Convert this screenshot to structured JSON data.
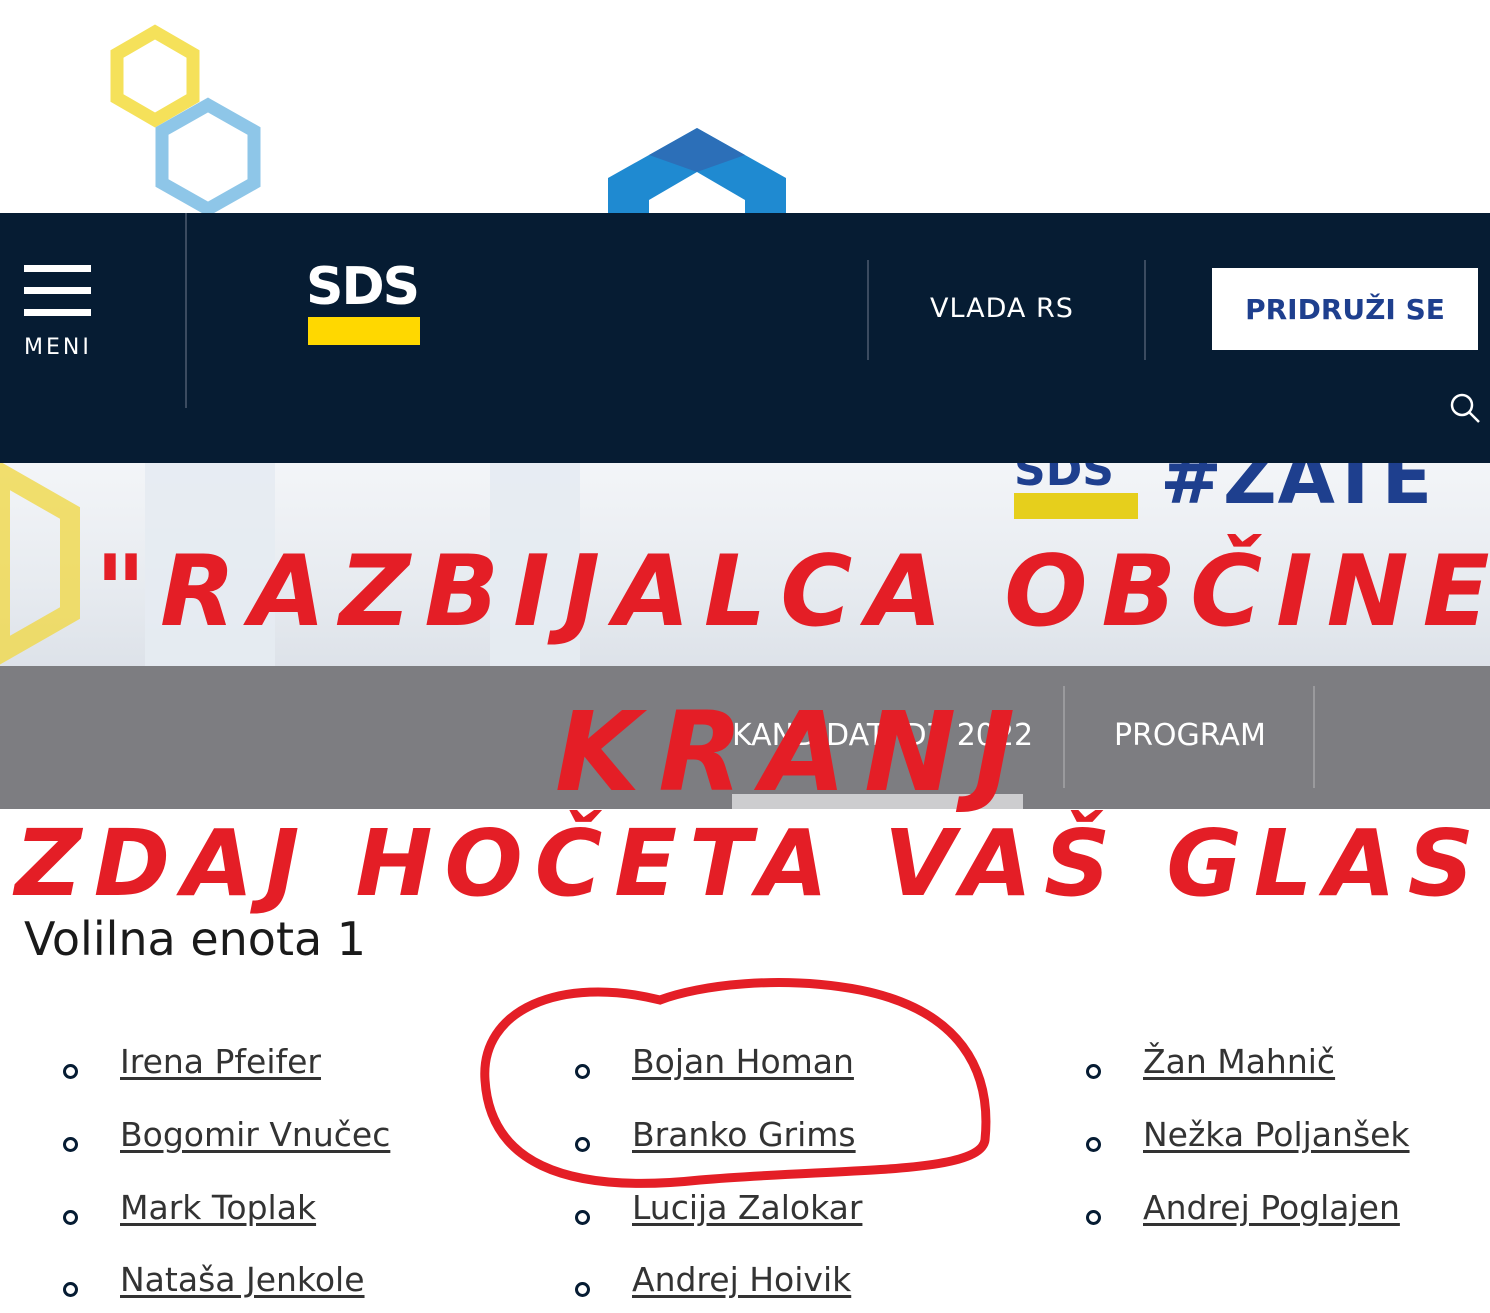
{
  "header": {
    "menu_label": "MENI",
    "logo_text": "SDS",
    "nav_link": "VLADA RS",
    "join_button": "PRIDRUŽI SE",
    "search_icon": "search-icon",
    "colors": {
      "navy": "#061c33",
      "brand_yellow": "#ffd800",
      "brand_blue": "#1e3f8e"
    }
  },
  "hero": {
    "banner_logo": "SDS",
    "banner_text": "#ZATE"
  },
  "subnav": {
    "items": [
      "KANDIDATI DZ 2022",
      "PROGRAM"
    ]
  },
  "section": {
    "title": "Volilna enota 1"
  },
  "candidates": {
    "col1": [
      "Irena Pfeifer",
      "Bogomir Vnučec",
      "Mark Toplak",
      "Nataša Jenkole"
    ],
    "col2": [
      "Bojan Homan",
      "Branko Grims",
      "Lucija Zalokar",
      "Andrej Hoivik"
    ],
    "col3": [
      "Žan Mahnič",
      "Nežka Poljanšek",
      "Andrej Poglajen"
    ]
  },
  "annotation": {
    "line1": "\"RAZBIJALCA OBČINE",
    "line2": "KRANJ",
    "line3": "ZDAJ HOČETA VAŠ GLAS",
    "color": "#e41e26"
  }
}
